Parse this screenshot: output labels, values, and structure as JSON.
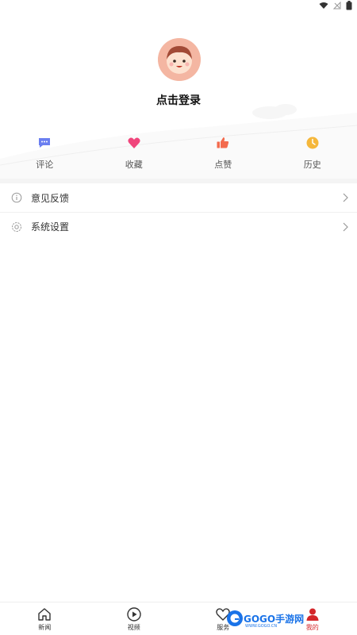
{
  "status_bar": {
    "icons": [
      "wifi-icon",
      "no-signal-icon",
      "battery-icon"
    ]
  },
  "profile": {
    "login_label": "点击登录",
    "avatar_icon": "avatar-icon"
  },
  "quick_actions": [
    {
      "label": "评论",
      "icon": "comment-icon",
      "color": "#6b7ff0"
    },
    {
      "label": "收藏",
      "icon": "heart-icon",
      "color": "#f0467c"
    },
    {
      "label": "点赞",
      "icon": "thumbs-up-icon",
      "color": "#f36b4e"
    },
    {
      "label": "历史",
      "icon": "clock-icon",
      "color": "#f5b73b"
    }
  ],
  "menu": [
    {
      "label": "意见反馈",
      "icon": "info-icon"
    },
    {
      "label": "系统设置",
      "icon": "gear-icon"
    }
  ],
  "tabbar": {
    "tabs": [
      {
        "label": "新闻",
        "icon": "home-icon"
      },
      {
        "label": "视频",
        "icon": "play-icon"
      },
      {
        "label": "服务",
        "icon": "heart-outline-icon"
      },
      {
        "label": "我的",
        "icon": "user-icon"
      }
    ],
    "active": "我的",
    "active_color": "#d4262a"
  },
  "watermark": {
    "text": "GOGO手游网",
    "sub": "WWW.GOGO.CN"
  }
}
